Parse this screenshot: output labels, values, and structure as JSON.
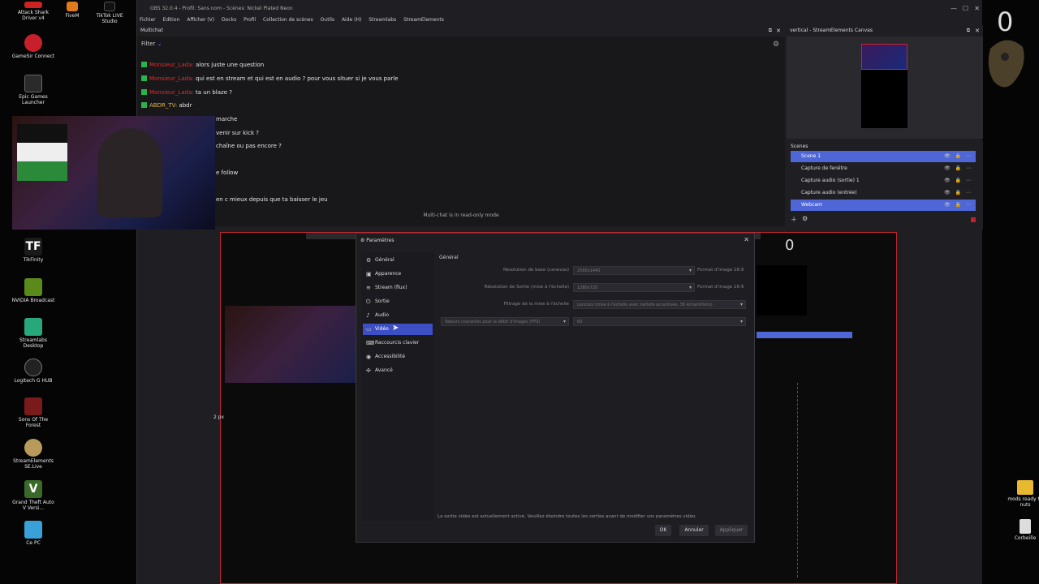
{
  "desktop": {
    "left_icons": [
      {
        "label": "Attack Shark Driver v4",
        "color": "#cc2222"
      },
      {
        "label": "GameSir Connect",
        "color": "#c8202a"
      },
      {
        "label": "Epic Games Launcher",
        "color": "#2a2a2a"
      },
      {
        "label": "TikFinity",
        "color": "#1a1a1a"
      },
      {
        "label": "NVIDIA Broadcast",
        "color": "#5a8a1a"
      },
      {
        "label": "Streamlabs Desktop",
        "color": "#28a87a"
      },
      {
        "label": "Logitech G HUB",
        "color": "#222222"
      },
      {
        "label": "Sons Of The Forest",
        "color": "#7a1a1a"
      },
      {
        "label": "StreamElements SE.Live",
        "color": "#b89a5a"
      },
      {
        "label": "Grand Theft Auto V Versi...",
        "color": "#3a6a2a"
      },
      {
        "label": "Ce PC",
        "color": "#3aa0d8"
      }
    ],
    "top_icons": [
      {
        "label": "FiveM",
        "color": "#e07a1a"
      },
      {
        "label": "TikTok LIVE Studio",
        "color": "#111111"
      }
    ],
    "right_icons": [
      {
        "label": "mods ready to nuts",
        "color": "#e8b830"
      },
      {
        "label": "Corbeille",
        "color": "#ddd"
      }
    ]
  },
  "obs": {
    "title": "OBS 32.0.4 - Profil: Sans nom - Scènes: Nickel Plated Neon",
    "menu": [
      "Fichier",
      "Edition",
      "Afficher (V)",
      "Docks",
      "Profil",
      "Collection de scènes",
      "Outils",
      "Aide (H)",
      "Streamlabs",
      "StreamElements"
    ],
    "chat_dock": {
      "title": "Multichat",
      "filter": "Filter",
      "readonly_notice": "Multi-chat is in read-only mode",
      "messages": [
        {
          "user": "Monsieur_Lada:",
          "text": "alors juste une question",
          "gold": false
        },
        {
          "user": "Monsieur_Lada:",
          "text": "qui est en stream et qui est en audio ? pour vous situer si je vous parle",
          "gold": false
        },
        {
          "user": "Monsieur_Lada:",
          "text": "ta un blaze ?",
          "gold": false
        },
        {
          "user": "ABDR_TV:",
          "text": "abdr",
          "gold": true
        },
        {
          "user": "",
          "text": "marche",
          "gold": false
        },
        {
          "user": "",
          "text": "venir sur kick ?",
          "gold": false
        },
        {
          "user": "",
          "text": "chaîne ou pas encore ?",
          "gold": false
        },
        {
          "user": "",
          "text": "e follow",
          "gold": false
        },
        {
          "user": "",
          "text": "en c mieux depuis que ta baisser le jeu",
          "gold": false
        }
      ]
    },
    "vertical_dock": {
      "title": "vertical - StreamElements Canvas"
    },
    "scenes_dock": {
      "title": "Scenes",
      "rows": [
        {
          "label": "Scene 1",
          "selected": true
        },
        {
          "label": "Capture de fenêtre",
          "selected": false
        },
        {
          "label": "Capture audio (sortie) 1",
          "selected": false
        },
        {
          "label": "Capture audio (entrée)",
          "selected": false
        },
        {
          "label": "Webcam",
          "selected": true
        }
      ]
    }
  },
  "settings": {
    "title": "Paramètres",
    "section": "Général",
    "nav": [
      {
        "label": "Général",
        "icon": "⚙"
      },
      {
        "label": "Apparence",
        "icon": "▣"
      },
      {
        "label": "Stream (flux)",
        "icon": "📶"
      },
      {
        "label": "Sortie",
        "icon": "⏻"
      },
      {
        "label": "Audio",
        "icon": "🔈"
      },
      {
        "label": "Vidéo",
        "icon": "▭"
      },
      {
        "label": "Raccourcis clavier",
        "icon": "⌨"
      },
      {
        "label": "Accessibilité",
        "icon": "◉"
      },
      {
        "label": "Avancé",
        "icon": "✣"
      }
    ],
    "selected_nav_index": 5,
    "fields": [
      {
        "label": "Résolution de base (canevas)",
        "value": "2560x1440",
        "extra": "Format d'image 16:9"
      },
      {
        "label": "Résolution de Sortie (mise à l'échelle)",
        "value": "1280x720",
        "extra": "Format d'image 16:9"
      },
      {
        "label": "Filtrage de la mise à l'échelle",
        "value": "Lanczos (mise à l'échelle avec netteté accentuée, 36 échantillons)",
        "extra": ""
      }
    ],
    "fps_label": "Valeurs courantes pour la débit d'images (FPS)",
    "fps_value": "60",
    "warning": "La sortie vidéo est actuellement active. Veuillez éteindre toutes les sorties avant de modifier vos paramètres vidéo.",
    "buttons": {
      "ok": "OK",
      "cancel": "Annuler",
      "apply": "Appliquer"
    }
  },
  "misc": {
    "px_label": "2 px",
    "zero": "0"
  }
}
